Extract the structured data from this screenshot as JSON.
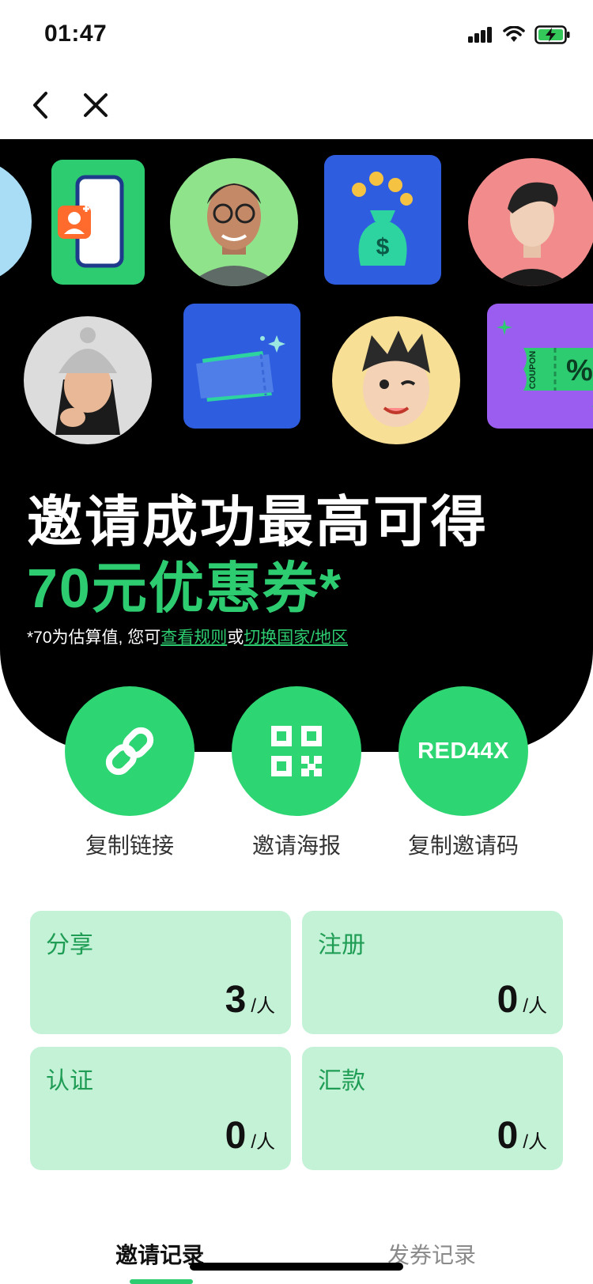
{
  "status_bar": {
    "time": "01:47"
  },
  "nav": {
    "back_icon": "chevron-left-icon",
    "close_icon": "close-icon"
  },
  "hero": {
    "headline": "邀请成功最高可得",
    "reward": "70元优惠券*",
    "disclaimer_prefix": "*70为估算值, 您可",
    "rules_link": "查看规则",
    "or_text": "或",
    "switch_region_link": "切换国家/地区",
    "coupon_text": "COUPON",
    "percent_text": "%"
  },
  "actions": [
    {
      "label": "复制链接",
      "icon": "link-icon"
    },
    {
      "label": "邀请海报",
      "icon": "qr-code-icon"
    },
    {
      "label": "复制邀请码",
      "code": "RED44X"
    }
  ],
  "stats": [
    {
      "label": "分享",
      "value": "3",
      "unit": "/人"
    },
    {
      "label": "注册",
      "value": "0",
      "unit": "/人"
    },
    {
      "label": "认证",
      "value": "0",
      "unit": "/人"
    },
    {
      "label": "汇款",
      "value": "0",
      "unit": "/人"
    }
  ],
  "tabs": [
    {
      "label": "邀请记录",
      "active": true
    },
    {
      "label": "发券记录",
      "active": false
    }
  ],
  "colors": {
    "accent": "#2ecc71",
    "button_green": "#2ed573",
    "card_bg": "#c4f2d6",
    "hero_bg": "#000000"
  }
}
